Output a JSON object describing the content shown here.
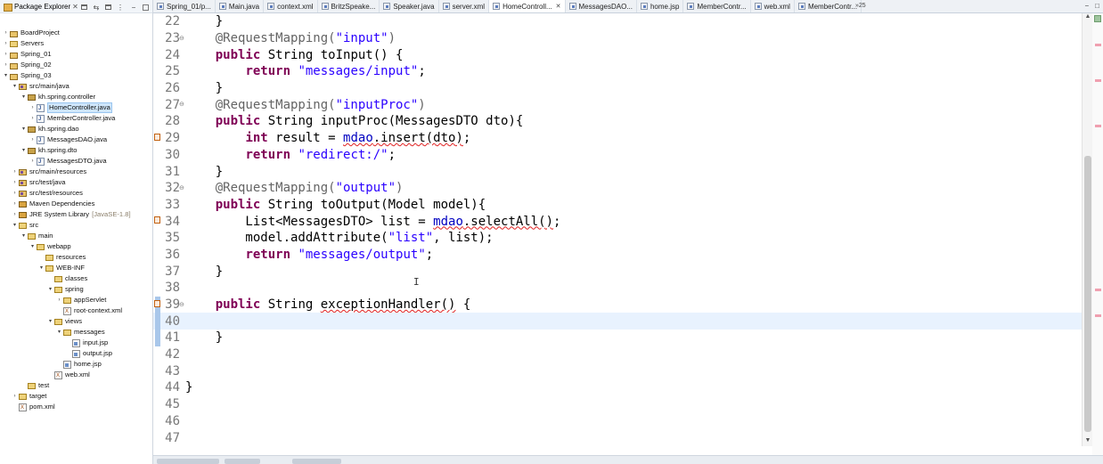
{
  "explorer": {
    "title": "Package Explorer",
    "close": "✕",
    "toolbar": [
      {
        "name": "collapse-all-icon",
        "glyph": ""
      },
      {
        "name": "link-with-editor-icon",
        "glyph": "⇆"
      },
      {
        "name": "focus-icon",
        "glyph": ""
      },
      {
        "name": "view-menu-icon",
        "glyph": "⋮"
      },
      {
        "name": "minimize-icon",
        "glyph": "−"
      },
      {
        "name": "maximize-icon",
        "glyph": ""
      }
    ],
    "tree": [
      {
        "label": "BoardProject",
        "icon": "project",
        "level": 0,
        "expanded": false
      },
      {
        "label": "Servers",
        "icon": "folder",
        "level": 0,
        "expanded": false
      },
      {
        "label": "Spring_01",
        "icon": "project",
        "level": 0,
        "expanded": false
      },
      {
        "label": "Spring_02",
        "icon": "project",
        "level": 0,
        "expanded": false
      },
      {
        "label": "Spring_03",
        "icon": "project",
        "level": 0,
        "expanded": true
      },
      {
        "label": "src/main/java",
        "icon": "src",
        "level": 1,
        "expanded": true
      },
      {
        "label": "kh.spring.controller",
        "icon": "pkg",
        "level": 2,
        "expanded": true
      },
      {
        "label": "HomeController.java",
        "icon": "java",
        "level": 3,
        "expanded": false,
        "selected": true
      },
      {
        "label": "MemberController.java",
        "icon": "java",
        "level": 3,
        "expanded": false
      },
      {
        "label": "kh.spring.dao",
        "icon": "pkg",
        "level": 2,
        "expanded": true
      },
      {
        "label": "MessagesDAO.java",
        "icon": "java",
        "level": 3,
        "expanded": false
      },
      {
        "label": "kh.spring.dto",
        "icon": "pkg",
        "level": 2,
        "expanded": true
      },
      {
        "label": "MessagesDTO.java",
        "icon": "java",
        "level": 3,
        "expanded": false
      },
      {
        "label": "src/main/resources",
        "icon": "src",
        "level": 1,
        "expanded": false
      },
      {
        "label": "src/test/java",
        "icon": "src",
        "level": 1,
        "expanded": false
      },
      {
        "label": "src/test/resources",
        "icon": "src",
        "level": 1,
        "expanded": false
      },
      {
        "label": "Maven Dependencies",
        "icon": "lib",
        "level": 1,
        "expanded": false
      },
      {
        "label": "JRE System Library",
        "suffix": "[JavaSE-1.8]",
        "icon": "lib",
        "level": 1,
        "expanded": false
      },
      {
        "label": "src",
        "icon": "folder",
        "level": 1,
        "expanded": true
      },
      {
        "label": "main",
        "icon": "folder",
        "level": 2,
        "expanded": true
      },
      {
        "label": "webapp",
        "icon": "folder",
        "level": 3,
        "expanded": true
      },
      {
        "label": "resources",
        "icon": "folder",
        "level": 4,
        "expanded": null
      },
      {
        "label": "WEB-INF",
        "icon": "folder",
        "level": 4,
        "expanded": true
      },
      {
        "label": "classes",
        "icon": "folder",
        "level": 5,
        "expanded": null
      },
      {
        "label": "spring",
        "icon": "folder",
        "level": 5,
        "expanded": true
      },
      {
        "label": "appServlet",
        "icon": "folder",
        "level": 6,
        "expanded": false
      },
      {
        "label": "root-context.xml",
        "icon": "xml",
        "level": 6,
        "expanded": null
      },
      {
        "label": "views",
        "icon": "folder",
        "level": 5,
        "expanded": true
      },
      {
        "label": "messages",
        "icon": "folder",
        "level": 6,
        "expanded": true
      },
      {
        "label": "input.jsp",
        "icon": "jsp",
        "level": 7,
        "expanded": null
      },
      {
        "label": "output.jsp",
        "icon": "jsp",
        "level": 7,
        "expanded": null
      },
      {
        "label": "home.jsp",
        "icon": "jsp",
        "level": 6,
        "expanded": null
      },
      {
        "label": "web.xml",
        "icon": "xml",
        "level": 5,
        "expanded": null
      },
      {
        "label": "test",
        "icon": "folder",
        "level": 2,
        "expanded": null
      },
      {
        "label": "target",
        "icon": "folder",
        "level": 1,
        "expanded": false
      },
      {
        "label": "pom.xml",
        "icon": "xml",
        "level": 1,
        "expanded": null
      }
    ]
  },
  "tabs": [
    {
      "label": "Spring_01/p...",
      "active": false
    },
    {
      "label": "Main.java",
      "active": false
    },
    {
      "label": "context.xml",
      "active": false
    },
    {
      "label": "BritzSpeake...",
      "active": false
    },
    {
      "label": "Speaker.java",
      "active": false
    },
    {
      "label": "server.xml",
      "active": false
    },
    {
      "label": "HomeControll...",
      "active": true
    },
    {
      "label": "MessagesDAO...",
      "active": false
    },
    {
      "label": "home.jsp",
      "active": false
    },
    {
      "label": "MemberContr...",
      "active": false
    },
    {
      "label": "web.xml",
      "active": false
    },
    {
      "label": "MemberContr...",
      "active": false
    }
  ],
  "tab_overflow": "»25",
  "tab_close": "✕",
  "win_ctrl": {
    "minimize": "−",
    "maximize": "□"
  },
  "editor": {
    "current_line": 40,
    "lines": [
      {
        "num": "22",
        "tokens": [
          [
            "",
            "    }"
          ]
        ]
      },
      {
        "num": "23",
        "fold": true,
        "tokens": [
          [
            "an",
            "    @RequestMapping("
          ],
          [
            "st",
            "\"input\""
          ],
          [
            "an",
            ")"
          ]
        ]
      },
      {
        "num": "24",
        "tokens": [
          [
            "",
            "    "
          ],
          [
            "kw",
            "public"
          ],
          [
            "",
            " String toInput() {"
          ]
        ]
      },
      {
        "num": "25",
        "tokens": [
          [
            "",
            "        "
          ],
          [
            "kw",
            "return"
          ],
          [
            "",
            " "
          ],
          [
            "st",
            "\"messages/input\""
          ],
          [
            "",
            ";"
          ]
        ]
      },
      {
        "num": "26",
        "tokens": [
          [
            "",
            "    }"
          ]
        ]
      },
      {
        "num": "27",
        "fold": true,
        "tokens": [
          [
            "an",
            "    @RequestMapping("
          ],
          [
            "st",
            "\"inputProc\""
          ],
          [
            "an",
            ")"
          ]
        ]
      },
      {
        "num": "28",
        "tokens": [
          [
            "",
            "    "
          ],
          [
            "kw",
            "public"
          ],
          [
            "",
            " String inputProc(MessagesDTO dto){"
          ]
        ]
      },
      {
        "num": "29",
        "marker": true,
        "tokens": [
          [
            "",
            "        "
          ],
          [
            "kw",
            "int"
          ],
          [
            "",
            " result = "
          ],
          [
            "flsq",
            "mdao"
          ],
          [
            "sq",
            ".insert(dto)"
          ],
          [
            "",
            ";"
          ]
        ]
      },
      {
        "num": "30",
        "tokens": [
          [
            "",
            "        "
          ],
          [
            "kw",
            "return"
          ],
          [
            "",
            " "
          ],
          [
            "st",
            "\"redirect:/\""
          ],
          [
            "",
            ";"
          ]
        ]
      },
      {
        "num": "31",
        "tokens": [
          [
            "",
            "    }"
          ]
        ]
      },
      {
        "num": "32",
        "fold": true,
        "tokens": [
          [
            "an",
            "    @RequestMapping("
          ],
          [
            "st",
            "\"output\""
          ],
          [
            "an",
            ")"
          ]
        ]
      },
      {
        "num": "33",
        "tokens": [
          [
            "",
            "    "
          ],
          [
            "kw",
            "public"
          ],
          [
            "",
            " String toOutput(Model model){"
          ]
        ]
      },
      {
        "num": "34",
        "marker": true,
        "tokens": [
          [
            "",
            "        List<MessagesDTO> list = "
          ],
          [
            "flsq",
            "mdao"
          ],
          [
            "sq",
            ".selectAll()"
          ],
          [
            "",
            ";"
          ]
        ]
      },
      {
        "num": "35",
        "tokens": [
          [
            "",
            "        model.addAttribute("
          ],
          [
            "st",
            "\"list\""
          ],
          [
            "",
            ", list);"
          ]
        ]
      },
      {
        "num": "36",
        "tokens": [
          [
            "",
            "        "
          ],
          [
            "kw",
            "return"
          ],
          [
            "",
            " "
          ],
          [
            "st",
            "\"messages/output\""
          ],
          [
            "",
            ";"
          ]
        ]
      },
      {
        "num": "37",
        "tokens": [
          [
            "",
            "    }"
          ]
        ]
      },
      {
        "num": "38",
        "tokens": [
          [
            "",
            ""
          ]
        ]
      },
      {
        "num": "39",
        "marker": true,
        "changed": true,
        "fold": true,
        "tokens": [
          [
            "",
            "    "
          ],
          [
            "kw",
            "public"
          ],
          [
            "",
            " String "
          ],
          [
            "sq",
            "exceptionHandler()"
          ],
          [
            "",
            " {"
          ]
        ]
      },
      {
        "num": "40",
        "changed": true,
        "tokens": [
          [
            "",
            ""
          ]
        ]
      },
      {
        "num": "41",
        "changed": true,
        "tokens": [
          [
            "",
            "    }"
          ]
        ]
      },
      {
        "num": "42",
        "tokens": [
          [
            "",
            ""
          ]
        ]
      },
      {
        "num": "43",
        "tokens": [
          [
            "",
            ""
          ]
        ]
      },
      {
        "num": "44",
        "tokens": [
          [
            "",
            "}"
          ]
        ]
      },
      {
        "num": "45",
        "tokens": [
          [
            "",
            ""
          ]
        ]
      },
      {
        "num": "46",
        "tokens": [
          [
            "",
            ""
          ]
        ]
      },
      {
        "num": "47",
        "tokens": [
          [
            "",
            ""
          ]
        ]
      }
    ]
  },
  "scroll": {
    "up": "▲",
    "down": "▼"
  },
  "text_cursor_icon": "I",
  "colors": {
    "keyword": "#7f0055",
    "string": "#2a00ff",
    "annotation": "#646464",
    "field": "#0000c0",
    "current_line": "#e8f2fe",
    "selection": "#cfe6fb"
  }
}
